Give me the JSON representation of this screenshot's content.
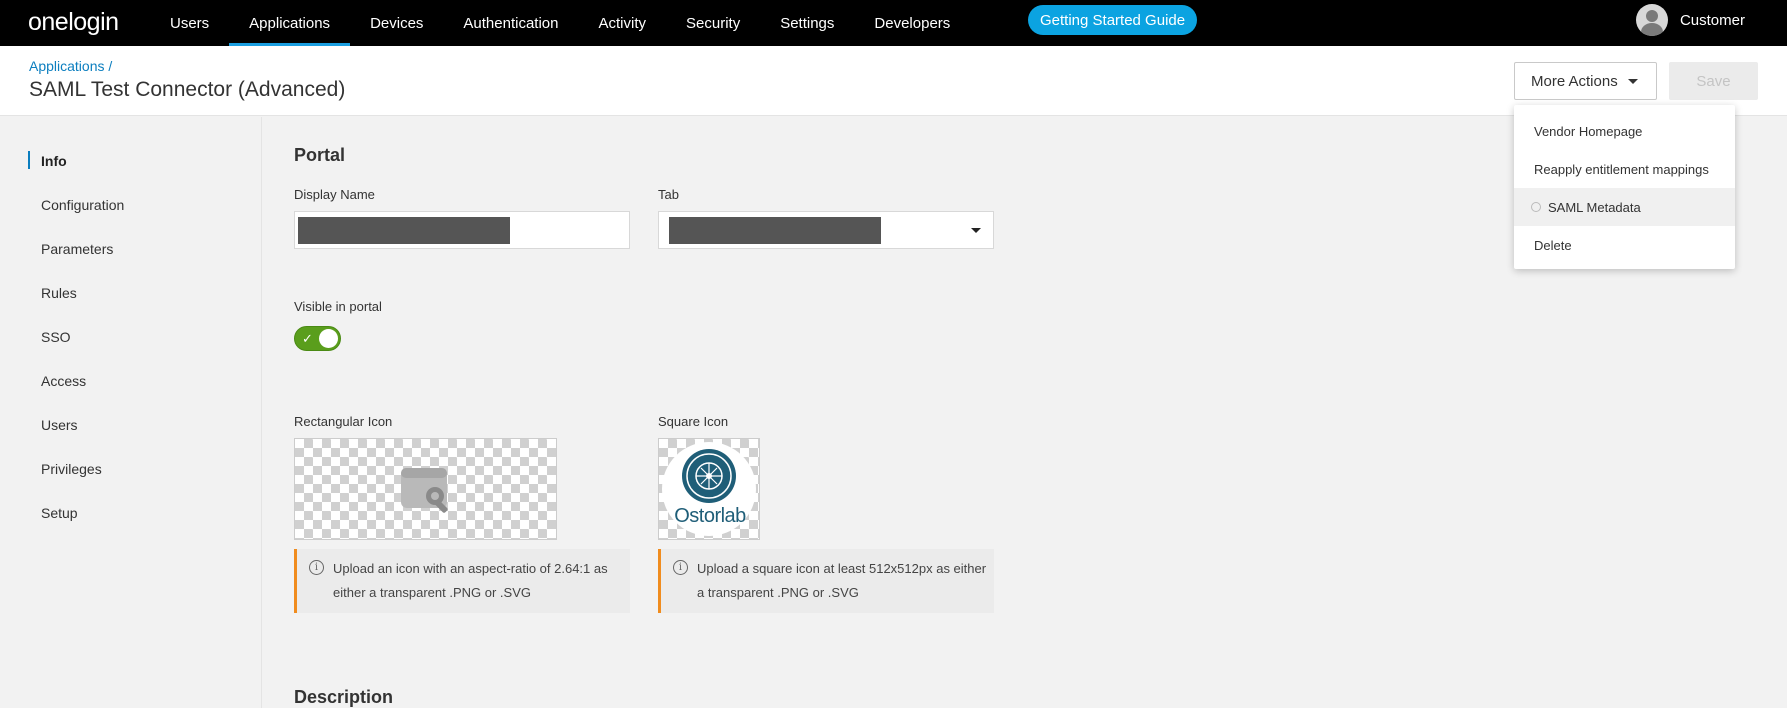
{
  "brand": {
    "logo": "onelogin"
  },
  "nav": {
    "items": [
      "Users",
      "Applications",
      "Devices",
      "Authentication",
      "Activity",
      "Security",
      "Settings",
      "Developers"
    ],
    "active": "Applications",
    "guide_button": "Getting Started Guide",
    "user_name": "Customer"
  },
  "header": {
    "breadcrumb": "Applications /",
    "title": "SAML Test Connector (Advanced)",
    "more_actions": "More Actions",
    "save": "Save"
  },
  "dropdown": {
    "items": [
      "Vendor Homepage",
      "Reapply entitlement mappings",
      "SAML Metadata",
      "Delete"
    ],
    "highlighted": "SAML Metadata"
  },
  "sidebar": {
    "items": [
      "Info",
      "Configuration",
      "Parameters",
      "Rules",
      "SSO",
      "Access",
      "Users",
      "Privileges",
      "Setup"
    ],
    "active": "Info"
  },
  "portal": {
    "section_title": "Portal",
    "display_name_label": "Display Name",
    "tab_label": "Tab",
    "visible_label": "Visible in portal",
    "visible": true,
    "rect_icon_label": "Rectangular Icon",
    "square_icon_label": "Square Icon",
    "square_icon_text": "Ostorlab",
    "rect_hint": "Upload an icon with an aspect-ratio of 2.64:1 as either a transparent .PNG or .SVG",
    "square_hint": "Upload a square icon at least 512x512px as either a transparent .PNG or .SVG"
  },
  "description": {
    "section_title": "Description"
  },
  "colors": {
    "accent": "#0b7ebf",
    "toggle_on": "#5a9e1c",
    "warning_border": "#f08c1e",
    "guide_bg": "#0ba3e1"
  }
}
